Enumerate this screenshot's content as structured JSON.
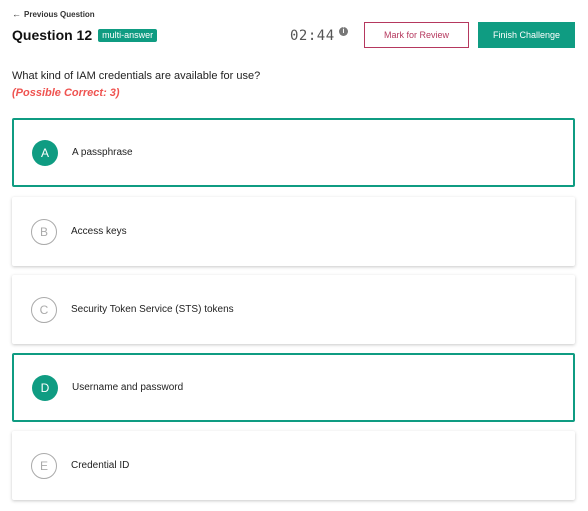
{
  "header": {
    "prev_label": "Previous Question",
    "question_title": "Question 12",
    "badge": "multi-answer",
    "timer": "02:44",
    "mark_review_label": "Mark for Review",
    "finish_label": "Finish Challenge"
  },
  "question": {
    "text": "What kind of IAM credentials are available for use?",
    "hint": "(Possible Correct: 3)"
  },
  "options": [
    {
      "letter": "A",
      "text": "A passphrase",
      "selected": true
    },
    {
      "letter": "B",
      "text": "Access keys",
      "selected": false
    },
    {
      "letter": "C",
      "text": "Security Token Service (STS) tokens",
      "selected": false
    },
    {
      "letter": "D",
      "text": "Username and password",
      "selected": true
    },
    {
      "letter": "E",
      "text": "Credential ID",
      "selected": false
    }
  ],
  "colors": {
    "accent": "#0f9c82",
    "review": "#b5385e",
    "hint": "#ef5350"
  },
  "icons": [
    "arrow-left-icon",
    "info-icon"
  ]
}
